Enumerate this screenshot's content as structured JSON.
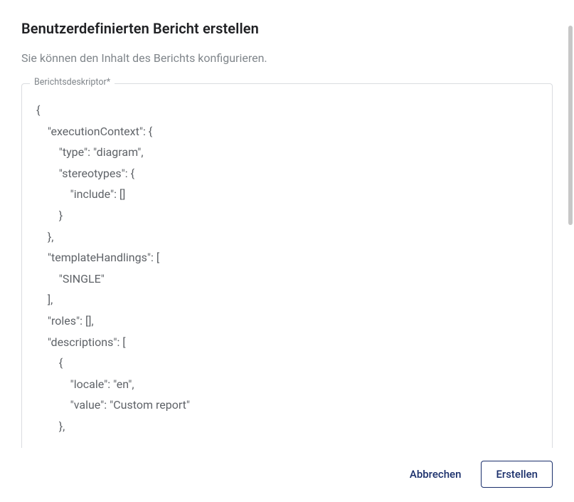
{
  "dialog": {
    "title": "Benutzerdefinierten Bericht erstellen",
    "subtitle": "Sie können den Inhalt des Berichts konfigurieren.",
    "field_label": "Berichtsdeskriptor*",
    "editor_value": "{\n    \"executionContext\": {\n        \"type\": \"diagram\",\n        \"stereotypes\": {\n            \"include\": []\n        }\n    },\n    \"templateHandlings\": [\n        \"SINGLE\"\n    ],\n    \"roles\": [],\n    \"descriptions\": [\n        {\n            \"locale\": \"en\",\n            \"value\": \"Custom report\"\n        },",
    "cancel_label": "Abbrechen",
    "create_label": "Erstellen"
  }
}
